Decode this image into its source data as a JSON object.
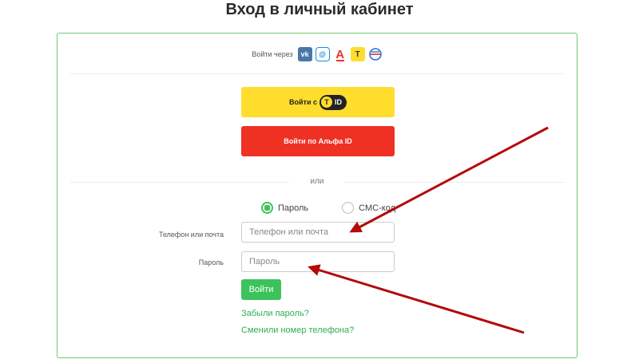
{
  "page": {
    "title": "Вход в личный кабинет"
  },
  "social": {
    "label": "Войти через",
    "items": [
      {
        "name": "vk",
        "glyph": "vk"
      },
      {
        "name": "mail",
        "glyph": "@"
      },
      {
        "name": "alfa",
        "glyph": "A"
      },
      {
        "name": "tinkoff",
        "glyph": "T"
      },
      {
        "name": "gosuslugi",
        "glyph": ""
      }
    ]
  },
  "buttons": {
    "tid_prefix": "Войти с",
    "tid_badge": "ID",
    "tid_shield": "T",
    "alfa": "Войти по Альфа ID",
    "submit": "Войти"
  },
  "divider_text": "или",
  "auth_mode": {
    "options": [
      {
        "label": "Пароль",
        "selected": true
      },
      {
        "label": "СМС-код",
        "selected": false
      }
    ]
  },
  "form": {
    "login_label": "Телефон или почта",
    "login_placeholder": "Телефон или почта",
    "password_label": "Пароль",
    "password_placeholder": "Пароль"
  },
  "links": {
    "forgot": "Забыли пароль?",
    "changed_phone": "Сменили номер телефона?"
  },
  "colors": {
    "accent": "#3cc35c",
    "tid_yellow": "#ffdd2d",
    "alfa_red": "#ef3124",
    "arrow": "#b30a0a"
  }
}
